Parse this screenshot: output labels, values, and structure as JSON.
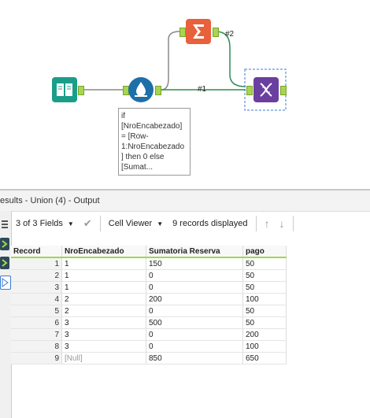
{
  "canvas": {
    "connections": {
      "c1": "#1",
      "c2": "#2"
    },
    "annotation": "if\n[NroEncabezado]\n= [Row-\n1:NroEncabezado\n] then 0 else\n[Sumat..."
  },
  "results": {
    "title": "esults - Union (4) - Output",
    "fields_label": "3 of 3 Fields",
    "viewer_label": "Cell Viewer",
    "records_label": "9 records displayed",
    "columns": [
      "Record",
      "NroEncabezado",
      "Sumatoria Reserva",
      "pago"
    ],
    "rows": [
      [
        "1",
        "1",
        "150",
        "50"
      ],
      [
        "2",
        "1",
        "0",
        "50"
      ],
      [
        "3",
        "1",
        "0",
        "50"
      ],
      [
        "4",
        "2",
        "200",
        "100"
      ],
      [
        "5",
        "2",
        "0",
        "50"
      ],
      [
        "6",
        "3",
        "500",
        "50"
      ],
      [
        "7",
        "3",
        "0",
        "200"
      ],
      [
        "8",
        "3",
        "0",
        "100"
      ],
      [
        "9",
        "[Null]",
        "850",
        "650"
      ]
    ]
  },
  "colors": {
    "accent_green": "#9fd84a",
    "summarize": "#e8603c",
    "formula": "#1e6fa8",
    "union": "#6b3fa0",
    "input": "#1a9e8a"
  }
}
